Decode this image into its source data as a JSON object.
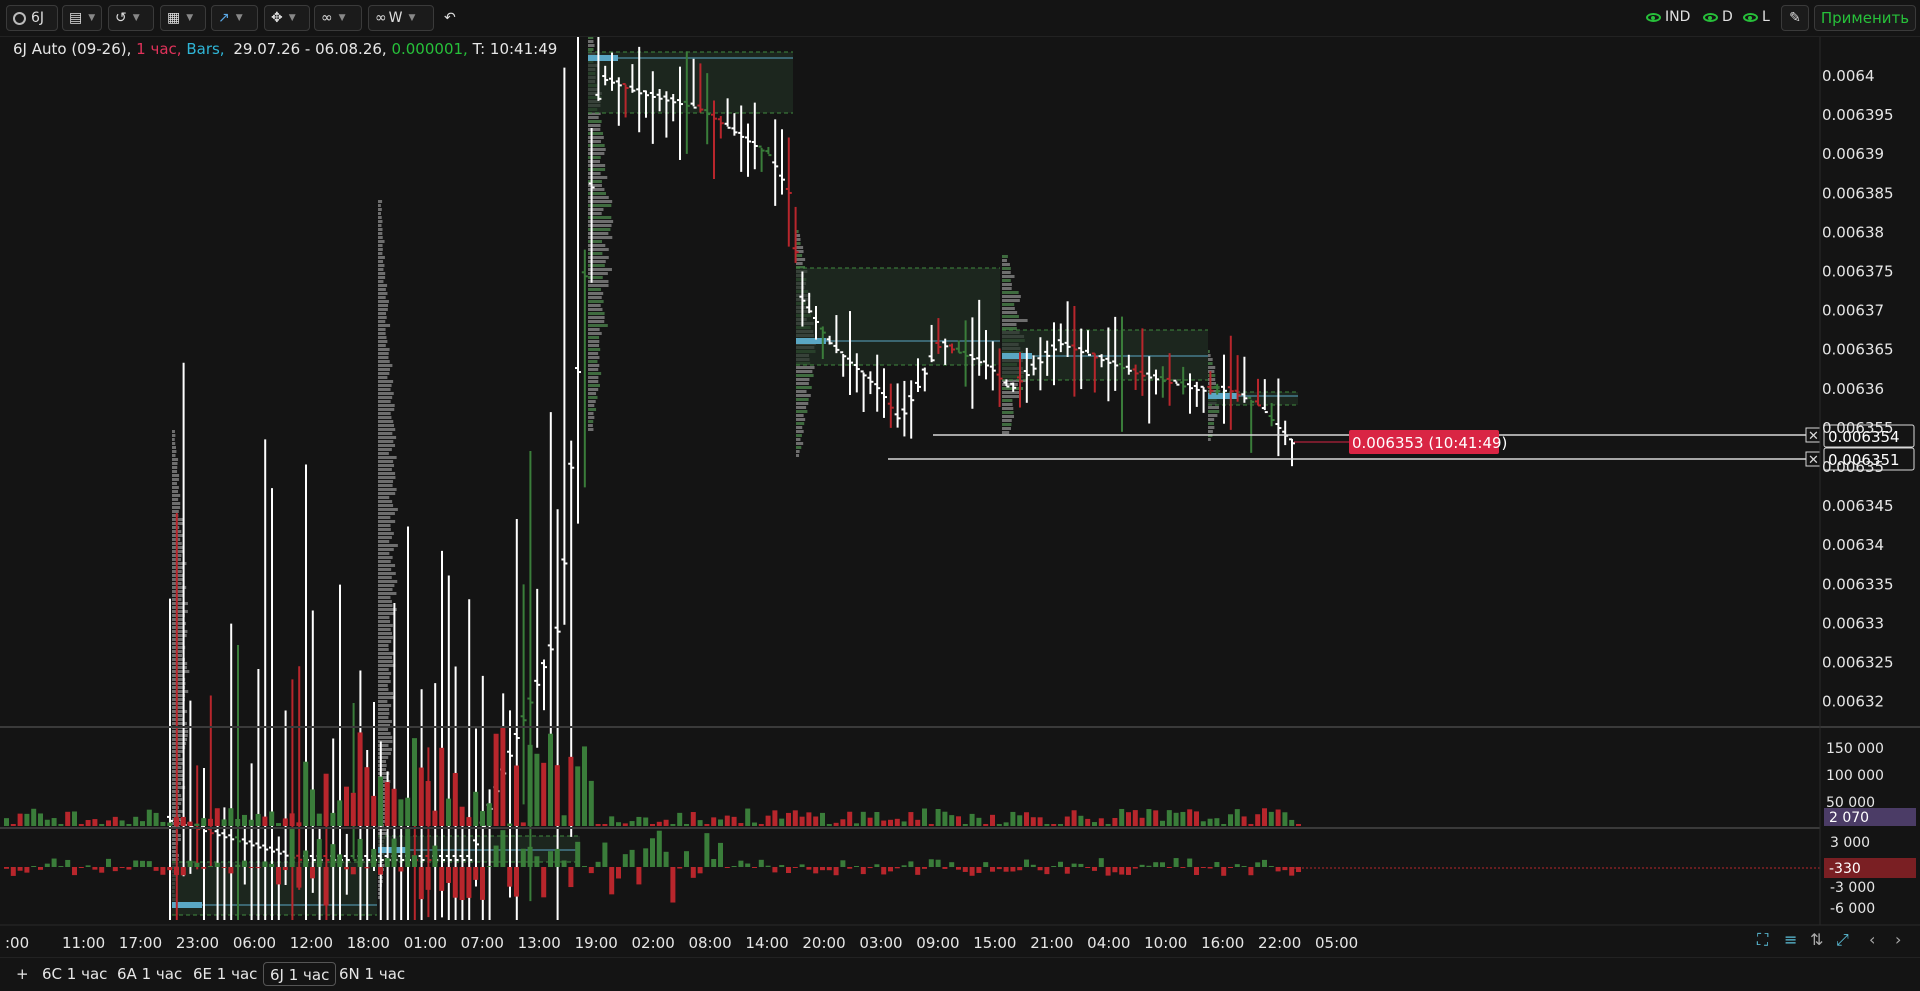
{
  "toolbar": {
    "symbol": "6J",
    "interval": "W",
    "toggles": [
      {
        "label": "IND",
        "icon": "eye-icon"
      },
      {
        "label": "D",
        "icon": "eye-icon"
      },
      {
        "label": "L",
        "icon": "eye-icon"
      }
    ],
    "apply_label": "Применить",
    "icons": [
      "search-icon",
      "template-icon",
      "history-icon",
      "calendar-icon",
      "indicator-icon",
      "crosshair-icon",
      "link-icon",
      "link-w-icon",
      "undo-icon",
      "pencil-icon"
    ]
  },
  "header": {
    "instrument": "6J Auto (09-26),",
    "timeframe": "1 час,",
    "chart_type": "Bars,",
    "date_range": "29.07.26 - 06.08.26,",
    "tick": "0.000001,",
    "time": "T: 10:41:49"
  },
  "colors": {
    "background": "#141414",
    "up": "#3a7d3a",
    "down": "#b8262c",
    "bar": "#ffffff",
    "poc": "#5aa7c4",
    "price_tag": "#d92544",
    "tick_info": "#27c03a",
    "timeframe_text": "#e0325a",
    "chart_type_text": "#2fb5d6",
    "delta_neg_label": "#7a1f23",
    "volume_label": "#4b3c66"
  },
  "chart_data": {
    "type": "bar",
    "price_axis": {
      "ticks": [
        "0.0064",
        "0.006395",
        "0.00639",
        "0.006385",
        "0.00638",
        "0.006375",
        "0.00637",
        "0.006365",
        "0.00636",
        "0.006355",
        "0.00635",
        "0.006345",
        "0.00634",
        "0.006335",
        "0.00633",
        "0.006325",
        "0.00632"
      ],
      "ylim": [
        0.006318,
        0.006405
      ]
    },
    "last_price": {
      "label": "0.006353 (10:41:49)",
      "value": 0.006353
    },
    "levels": [
      {
        "label": "0.006354",
        "value": 0.006354
      },
      {
        "label": "0.00635",
        "value": 0.00635
      },
      {
        "label": "0.006351",
        "value": 0.006351
      }
    ],
    "time_axis": [
      ":00",
      "11:00",
      "17:00",
      "23:00",
      "06:00",
      "12:00",
      "18:00",
      "01:00",
      "07:00",
      "13:00",
      "19:00",
      "02:00",
      "08:00",
      "14:00",
      "20:00",
      "03:00",
      "09:00",
      "15:00",
      "21:00",
      "04:00",
      "10:00",
      "16:00",
      "22:00",
      "05:00"
    ],
    "volume_axis": {
      "ticks": [
        "150 000",
        "100 000",
        "50 000"
      ],
      "current_label": "2 070",
      "current": 2070
    },
    "delta_axis": {
      "ticks": [
        "3 000",
        "-3 000",
        "-6 000"
      ],
      "current_label": "-330",
      "current": -330
    }
  },
  "tabs": [
    {
      "label": "+"
    },
    {
      "label": "6C 1 час"
    },
    {
      "label": "6A 1 час"
    },
    {
      "label": "6E 1 час"
    },
    {
      "label": "6J 1 час",
      "active": true
    },
    {
      "label": "6N 1 час"
    }
  ]
}
